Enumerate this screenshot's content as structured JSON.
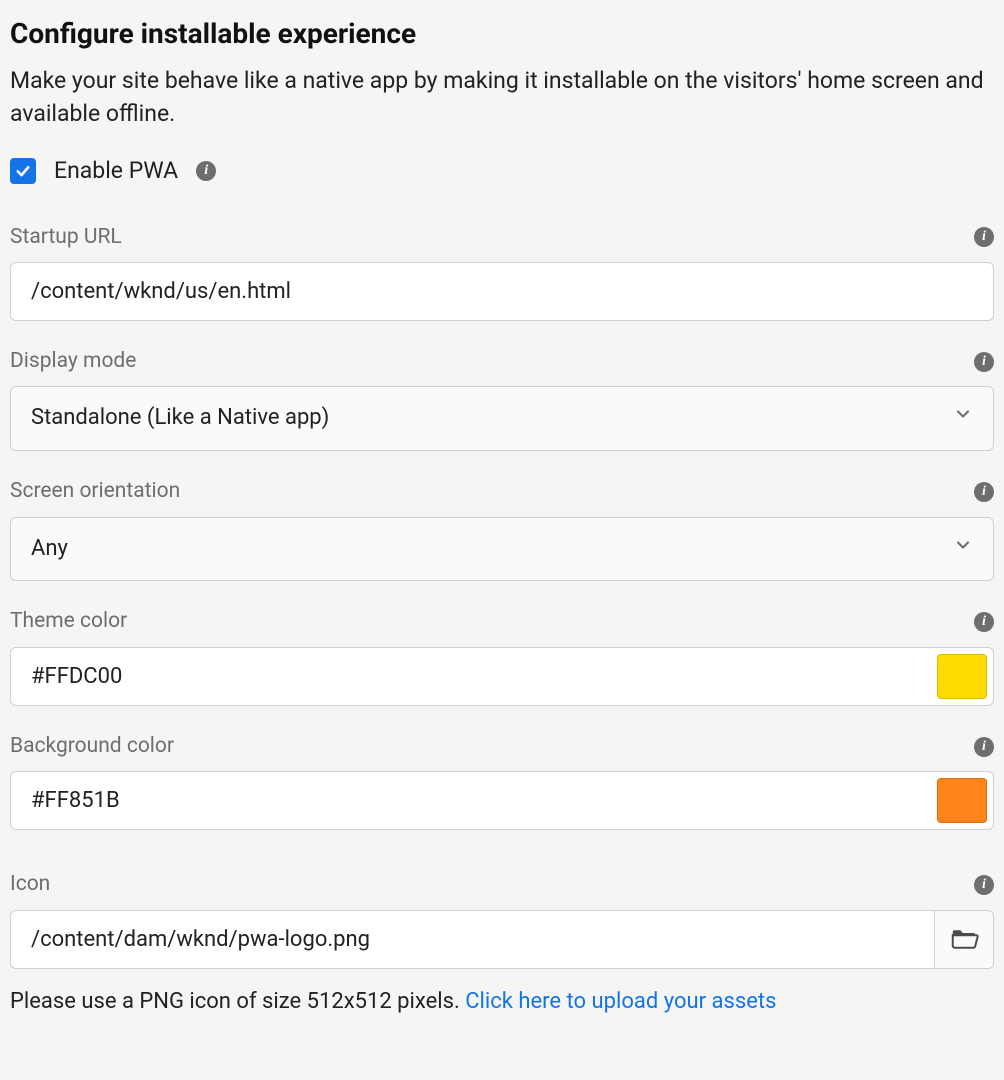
{
  "header": {
    "title": "Configure installable experience",
    "description": "Make your site behave like a native app by making it installable on the visitors' home screen and available offline."
  },
  "enable": {
    "label": "Enable PWA",
    "checked": true
  },
  "fields": {
    "startup_url": {
      "label": "Startup URL",
      "value": "/content/wknd/us/en.html"
    },
    "display_mode": {
      "label": "Display mode",
      "value": "Standalone (Like a Native app)"
    },
    "screen_orientation": {
      "label": "Screen orientation",
      "value": "Any"
    },
    "theme_color": {
      "label": "Theme color",
      "value": "#FFDC00",
      "swatch": "#FFDC00"
    },
    "background_color": {
      "label": "Background color",
      "value": "#FF851B",
      "swatch": "#FF851B"
    },
    "icon": {
      "label": "Icon",
      "value": "/content/dam/wknd/pwa-logo.png",
      "hint_prefix": "Please use a PNG icon of size 512x512 pixels. ",
      "hint_link": "Click here to upload your assets"
    }
  }
}
